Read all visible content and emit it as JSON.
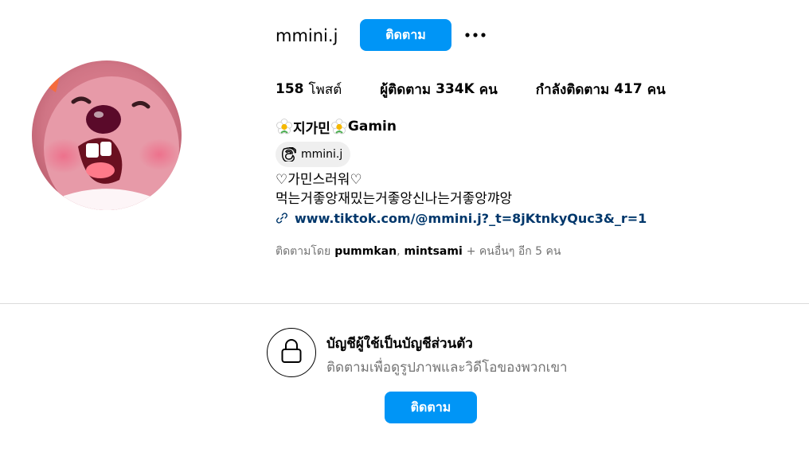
{
  "profile": {
    "username": "mmini.j",
    "follow_label": "ติดตาม",
    "more_icon": "more-options-icon"
  },
  "stats": {
    "posts_count": "158",
    "posts_label": "โพสต์",
    "followers_label": "ผู้ติดตาม",
    "followers_count": "334K",
    "followers_unit": "คน",
    "following_label": "กำลังติดตาม",
    "following_count": "417",
    "following_unit": "คน"
  },
  "bio": {
    "display_name_part1": "지가민",
    "display_name_part2": "Gamin",
    "threads_handle": "mmini.j",
    "line1": "♡가민스러워♡",
    "line2": "먹는거좋앙재밌는거좋앙신나는거좋앙꺄앙",
    "link_text": "www.tiktok.com/@mmini.j?_t=8jKtnkyQuc3&_r=1"
  },
  "followed_by": {
    "prefix": "ติดตามโดย",
    "name1": "pummkan",
    "separator": ",",
    "name2": "mintsami",
    "suffix": "+ คนอื่นๆ อีก 5 คน"
  },
  "private_notice": {
    "title": "บัญชีผู้ใช้เป็นบัญชีส่วนตัว",
    "subtitle": "ติดตามเพื่อดูรูปภาพและวิดีโอของพวกเขา",
    "follow_label": "ติดตาม"
  },
  "colors": {
    "accent": "#0095f6",
    "link": "#00376b",
    "secondary_text": "#737373",
    "divider": "#dbdbdb"
  }
}
